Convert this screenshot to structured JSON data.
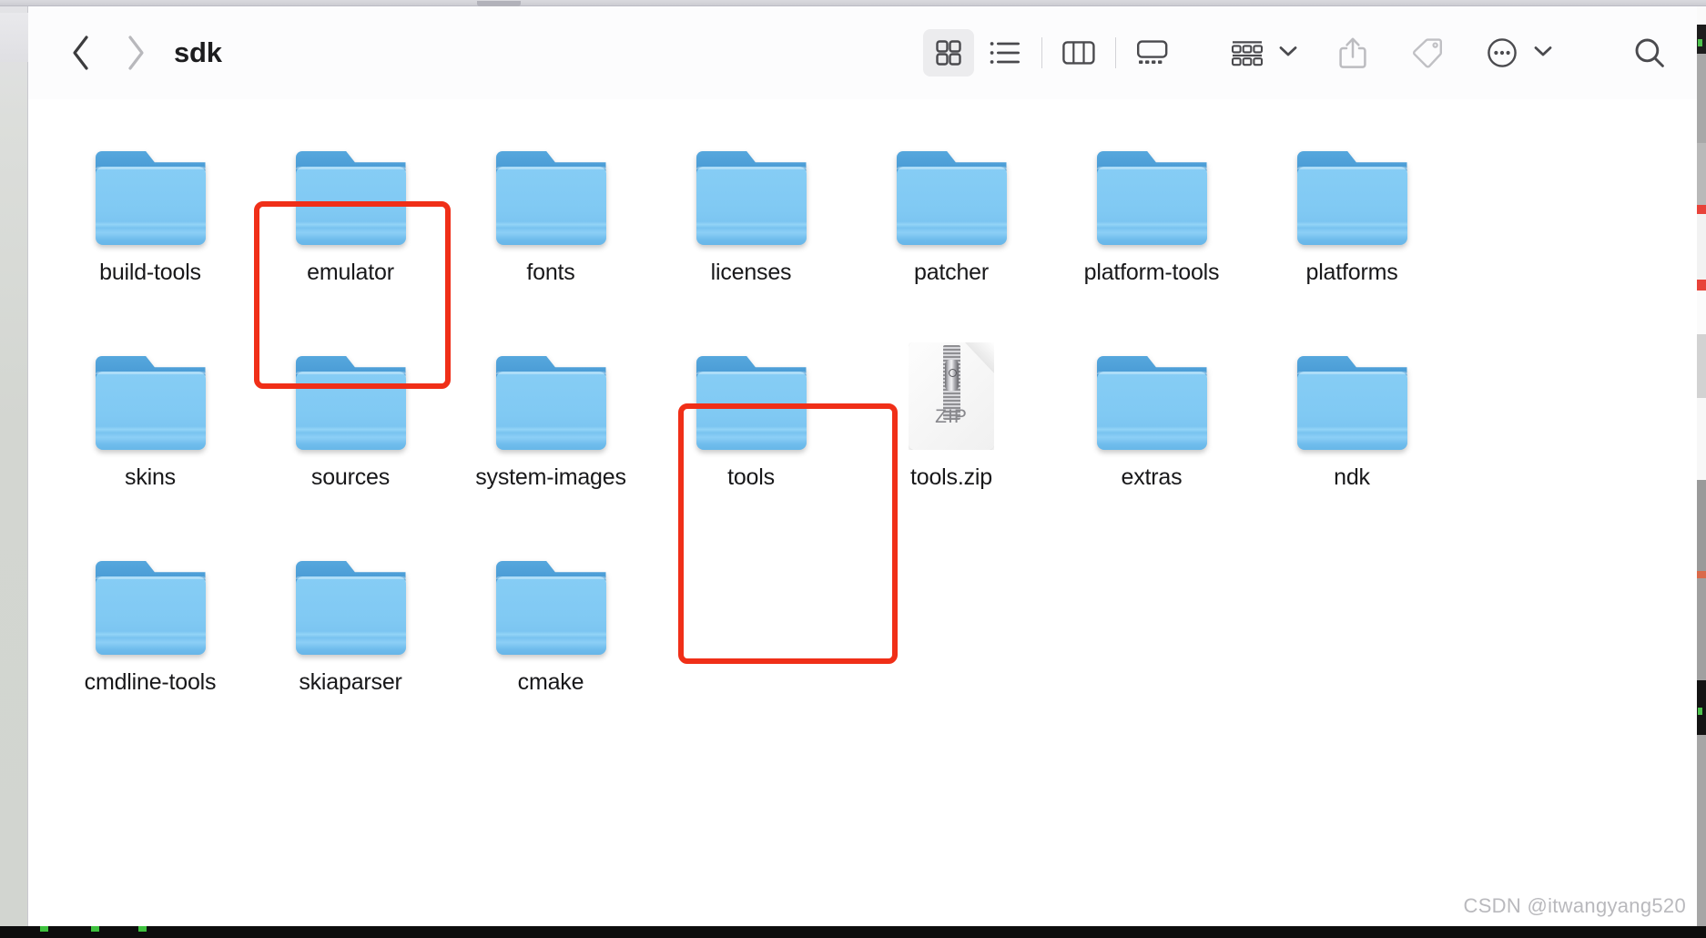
{
  "window": {
    "app": "Finder",
    "title": "sdk"
  },
  "toolbar": {
    "back_label": "Back",
    "forward_label": "Forward",
    "path_title": "sdk",
    "view_modes": [
      {
        "name": "icon-view",
        "label": "as Icons",
        "icon": "grid-icon",
        "active": true
      },
      {
        "name": "list-view",
        "label": "as List",
        "icon": "list-icon",
        "active": false
      },
      {
        "name": "column-view",
        "label": "as Columns",
        "icon": "columns-icon",
        "active": false
      },
      {
        "name": "gallery-view",
        "label": "as Gallery",
        "icon": "gallery-icon",
        "active": false
      }
    ],
    "group_label": "Group",
    "share_label": "Share",
    "tags_label": "Tags",
    "more_label": "More",
    "search_label": "Search"
  },
  "items": [
    [
      {
        "name": "build-tools",
        "type": "folder",
        "label": "build-tools",
        "highlighted": false
      },
      {
        "name": "emulator",
        "type": "folder",
        "label": "emulator",
        "highlighted": true
      },
      {
        "name": "fonts",
        "type": "folder",
        "label": "fonts",
        "highlighted": false
      },
      {
        "name": "licenses",
        "type": "folder",
        "label": "licenses",
        "highlighted": false
      },
      {
        "name": "patcher",
        "type": "folder",
        "label": "patcher",
        "highlighted": false
      },
      {
        "name": "platform-tools",
        "type": "folder",
        "label": "platform-tools",
        "highlighted": false
      },
      {
        "name": "platforms",
        "type": "folder",
        "label": "platforms",
        "highlighted": false
      }
    ],
    [
      {
        "name": "skins",
        "type": "folder",
        "label": "skins",
        "highlighted": false
      },
      {
        "name": "sources",
        "type": "folder",
        "label": "sources",
        "highlighted": false
      },
      {
        "name": "system-images",
        "type": "folder",
        "label": "system-images",
        "highlighted": false
      },
      {
        "name": "tools",
        "type": "folder",
        "label": "tools",
        "highlighted": true
      },
      {
        "name": "tools.zip",
        "type": "zip",
        "label": "tools.zip",
        "badge": "ZIP",
        "highlighted": false
      },
      {
        "name": "extras",
        "type": "folder",
        "label": "extras",
        "highlighted": false
      },
      {
        "name": "ndk",
        "type": "folder",
        "label": "ndk",
        "highlighted": false
      }
    ],
    [
      {
        "name": "cmdline-tools",
        "type": "folder",
        "label": "cmdline-tools",
        "highlighted": false
      },
      {
        "name": "skiaparser",
        "type": "folder",
        "label": "skiaparser",
        "highlighted": false
      },
      {
        "name": "cmake",
        "type": "folder",
        "label": "cmake",
        "highlighted": false
      }
    ]
  ],
  "annotations": [
    {
      "name": "emulator-highlight",
      "target": "emulator",
      "color": "#f02f18"
    },
    {
      "name": "tools-highlight",
      "target": "tools",
      "color": "#f02f18"
    }
  ],
  "watermark": {
    "text": "CSDN @itwangyang520"
  },
  "colors": {
    "folder_tab": "#3f92cf",
    "folder_body": "#80c9f3",
    "annotation_red": "#f02f18",
    "toolbar_bg": "#fcfcfd",
    "content_bg": "#ffffff",
    "label_text": "#18181a"
  }
}
